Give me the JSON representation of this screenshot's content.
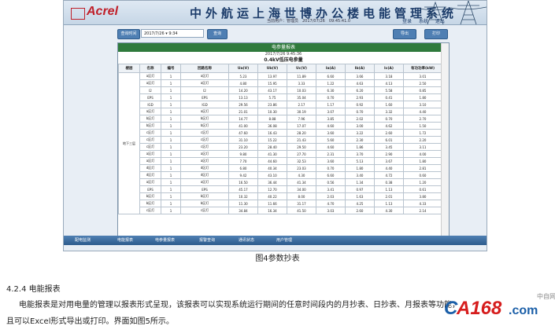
{
  "brand": {
    "mark": "",
    "name": "Acrel"
  },
  "app_title": "中外航运上海世博办公楼电能管理系统",
  "userline": "当前用户：管理员　2017/07/26　09:45:41.0",
  "top_links": [
    "登录",
    "系统",
    "退出"
  ],
  "toolbar": {
    "query_label": "查询时间",
    "date_value": "2017/7/26  ▾ 9:34",
    "search_label": "查询",
    "export_label": "导出",
    "print_label": "打印"
  },
  "report": {
    "header": "电参量报表",
    "date": "2017/7/26 9:45:36",
    "subtitle": "0.4kV低压电参量",
    "columns": [
      "楼层",
      "名称",
      "编号",
      "回路名称",
      "Ua(V)",
      "Ub(V)",
      "Uc(V)",
      "Ia(A)",
      "Ib(A)",
      "Ic(A)",
      "有功功率(kW)"
    ],
    "floor": "地下三层",
    "rows": [
      [
        "a区灯",
        "1",
        "a区灯",
        "5.23",
        "13.97",
        "11.89",
        "6.60",
        "3.66",
        "3.18",
        "3.01"
      ],
      [
        "a区灯",
        "1",
        "a区灯",
        "4.80",
        "15.95",
        "3.33",
        "1.22",
        "4.63",
        "4.13",
        "2.50"
      ],
      [
        "I2",
        "1",
        "I2",
        "14.20",
        "43.17",
        "10.03",
        "6.30",
        "6.20",
        "5.58",
        "0.85"
      ],
      [
        "EPS",
        "1",
        "EPS",
        "13.13",
        "5.75",
        "35.04",
        "0.70",
        "2.93",
        "0.41",
        "1.80"
      ],
      [
        "IGD",
        "1",
        "IGD",
        "29.56",
        "23.86",
        "2.17",
        "1.17",
        "0.92",
        "1.60",
        "3.10"
      ],
      [
        "a区灯",
        "1",
        "a区灯",
        "21.01",
        "10.30",
        "30.19",
        "3.07",
        "0.70",
        "3.32",
        "4.40"
      ],
      [
        "b区灯",
        "1",
        "b区灯",
        "14.77",
        "8.88",
        "7.96",
        "3.85",
        "2.02",
        "0.70",
        "2.70"
      ],
      [
        "b区灯",
        "1",
        "b区灯",
        "41.00",
        "36.08",
        "17.07",
        "4.60",
        "3.00",
        "4.62",
        "1.50"
      ],
      [
        "c区灯",
        "1",
        "c区灯",
        "47.60",
        "16.43",
        "28.20",
        "3.60",
        "3.22",
        "2.60",
        "1.72"
      ],
      [
        "c区灯",
        "1",
        "c区灯",
        "31.10",
        "15.22",
        "21.43",
        "5.60",
        "2.30",
        "6.01",
        "2.20"
      ],
      [
        "c区灯",
        "1",
        "c区灯",
        "23.20",
        "28.40",
        "29.50",
        "4.60",
        "1.86",
        "3.45",
        "3.11"
      ],
      [
        "a区灯",
        "1",
        "a区灯",
        "9.80",
        "41.30",
        "27.70",
        "2.31",
        "3.70",
        "2.90",
        "4.00"
      ],
      [
        "a区灯",
        "1",
        "a区灯",
        "7.70",
        "44.60",
        "32.53",
        "3.60",
        "5.13",
        "3.67",
        "1.80"
      ],
      [
        "d区灯",
        "1",
        "d区灯",
        "6.80",
        "40.34",
        "23.03",
        "0.70",
        "1.80",
        "4.40",
        "2.81"
      ],
      [
        "d区灯",
        "1",
        "d区灯",
        "9.42",
        "43.10",
        "4.30",
        "6.60",
        "3.40",
        "4.72",
        "0.60"
      ],
      [
        "a区灯",
        "1",
        "a区灯",
        "16.50",
        "36.44",
        "41.34",
        "0.56",
        "1.34",
        "0.38",
        "1.20"
      ],
      [
        "EPS",
        "1",
        "EPS",
        "45.17",
        "12.70",
        "34.00",
        "3.41",
        "0.97",
        "1.13",
        "0.61"
      ],
      [
        "b区灯",
        "1",
        "b区灯",
        "10.32",
        "40.22",
        "8.00",
        "2.03",
        "1.63",
        "2.01",
        "3.80"
      ],
      [
        "b区灯",
        "1",
        "b区灯",
        "11.30",
        "11.66",
        "31.17",
        "4.70",
        "4.25",
        "1.13",
        "4.33"
      ],
      [
        "c区灯",
        "1",
        "c区灯",
        "34.84",
        "16.34",
        "41.50",
        "3.03",
        "2.60",
        "4.30",
        "2.14"
      ]
    ]
  },
  "nav": [
    "配电监测",
    "电能报表",
    "电参量报表",
    "报警查询",
    "通讯状态",
    "用户管理"
  ],
  "caption": "图4参数抄表",
  "section": "4.2.4 电能报表",
  "para1": "电能报表是对用电量的管理以报表形式呈现，该报表可以实现系统运行期间的任意时间段内的月抄表、日抄表、月报表等功能，",
  "para2": "且可以Excel形式导出或打印。界面如图5所示。",
  "watermark": {
    "prefix": "C",
    "highlight": "A168",
    "suffix": ".com",
    "tag": "中自网"
  },
  "colors": {
    "brand": "#c0202a",
    "report_header": "#2f7a3c",
    "nav": "#2d5b8c"
  }
}
